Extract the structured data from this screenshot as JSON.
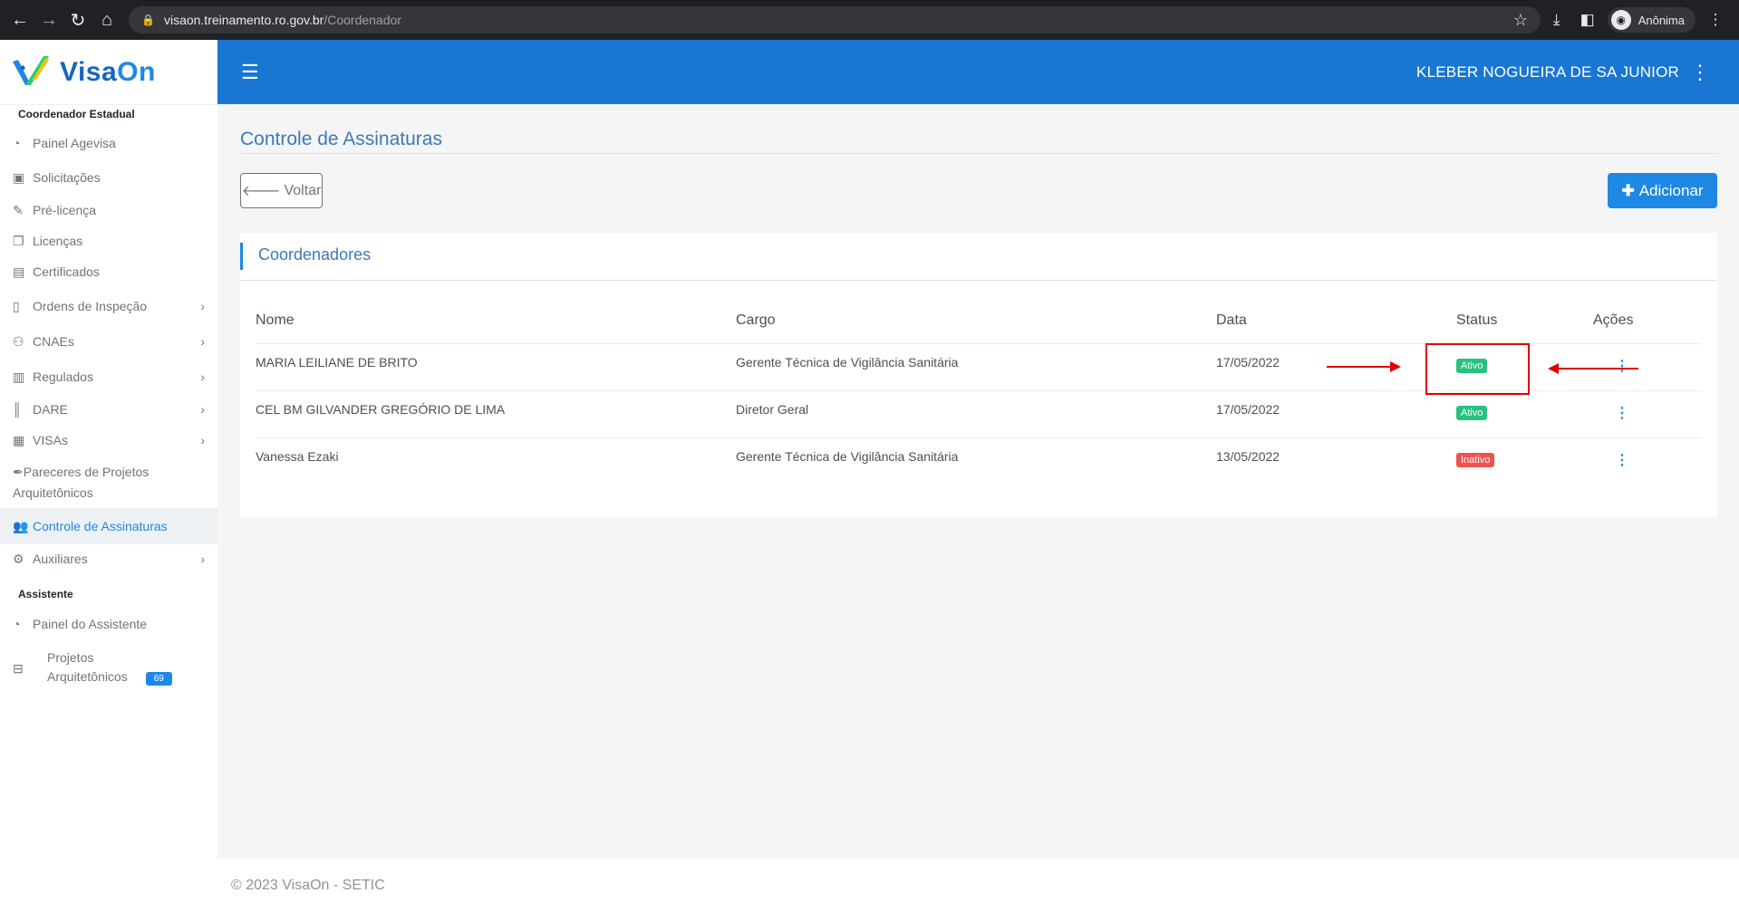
{
  "browser": {
    "url_domain": "visaon.treinamento.ro.gov.br",
    "url_path": "/Coordenador",
    "profile_label": "Anônima"
  },
  "app": {
    "name_part1": "Visa",
    "name_part2": "On"
  },
  "sidebar": {
    "section1": "Coordenador Estadual",
    "items": [
      {
        "label": "Painel Agevisa",
        "icon": "dashboard-icon"
      },
      {
        "label": "Solicitações",
        "icon": "clipboard-icon"
      },
      {
        "label": "Pré-licença",
        "icon": "edit-icon"
      },
      {
        "label": "Licenças",
        "icon": "copy-icon"
      },
      {
        "label": "Certificados",
        "icon": "document-icon"
      },
      {
        "label": "Ordens de Inspeção",
        "icon": "file-icon"
      },
      {
        "label": "CNAEs",
        "icon": "sitemap-icon"
      },
      {
        "label": "Regulados",
        "icon": "file-list-icon"
      },
      {
        "label": "DARE",
        "icon": "barcode-icon"
      },
      {
        "label": "VISAs",
        "icon": "building-icon"
      },
      {
        "label_line1": "Pareceres de Projetos",
        "label_line2": "Arquitetônicos",
        "icon": "feather-icon"
      },
      {
        "label": "Controle de Assinaturas",
        "icon": "users-icon"
      },
      {
        "label": "Auxiliares",
        "icon": "gears-icon"
      }
    ],
    "section2": "Assistente",
    "assistant_items": [
      {
        "label": "Painel do Assistente",
        "icon": "dashboard-icon"
      },
      {
        "label_line1": "Projetos",
        "label_line2": "Arquitetônicos",
        "icon": "blueprint-icon",
        "badge": "69"
      }
    ]
  },
  "header": {
    "user": "KLEBER NOGUEIRA DE SA JUNIOR"
  },
  "page": {
    "title": "Controle de Assinaturas",
    "back_label": "Voltar",
    "add_label": "Adicionar",
    "card_title": "Coordenadores"
  },
  "table": {
    "headers": [
      "Nome",
      "Cargo",
      "Data",
      "Status",
      "Ações"
    ],
    "rows": [
      {
        "nome": "MARIA LEILIANE DE BRITO",
        "cargo": "Gerente Técnica de Vigilância Sanitária",
        "data": "17/05/2022",
        "status": "Ativo"
      },
      {
        "nome": "CEL BM GILVANDER GREGÓRIO DE LIMA",
        "cargo": "Diretor Geral",
        "data": "17/05/2022",
        "status": "Ativo"
      },
      {
        "nome": "Vanessa Ezaki",
        "cargo": "Gerente Técnica de Vigilância Sanitária",
        "data": "13/05/2022",
        "status": "Inativo"
      }
    ]
  },
  "footer": {
    "text": "© 2023 VisaOn - SETIC"
  },
  "colors": {
    "primary": "#1976d2",
    "accent": "#1e88e5",
    "active_badge": "#26c281",
    "inactive_badge": "#ef5350",
    "annotation": "#e00000"
  }
}
